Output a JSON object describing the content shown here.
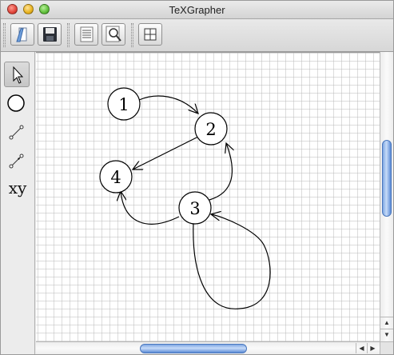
{
  "window": {
    "title": "TeXGrapher"
  },
  "toolbar": {
    "buttons": [
      {
        "name": "open-button",
        "icon": "open-document-icon"
      },
      {
        "name": "save-button",
        "icon": "floppy-disk-icon"
      },
      {
        "name": "list-view-button",
        "icon": "list-icon"
      },
      {
        "name": "zoom-button",
        "icon": "magnifier-icon"
      },
      {
        "name": "grid-button",
        "icon": "grid-icon"
      }
    ]
  },
  "tools": {
    "items": [
      "select-arrow",
      "circle-node",
      "edge",
      "directed-edge",
      "label"
    ],
    "label_tool_text": "xy"
  },
  "graph": {
    "nodes": [
      {
        "id": "node-1",
        "label": "1"
      },
      {
        "id": "node-2",
        "label": "2"
      },
      {
        "id": "node-3",
        "label": "3"
      },
      {
        "id": "node-4",
        "label": "4"
      }
    ],
    "edges": [
      {
        "from": "1",
        "to": "2"
      },
      {
        "from": "2",
        "to": "4"
      },
      {
        "from": "3",
        "to": "2"
      },
      {
        "from": "3",
        "to": "4"
      },
      {
        "from": "3",
        "to": "3"
      }
    ]
  },
  "colors": {
    "scroll_thumb": "#6e9be0",
    "grid_line": "#b9b9b9"
  }
}
